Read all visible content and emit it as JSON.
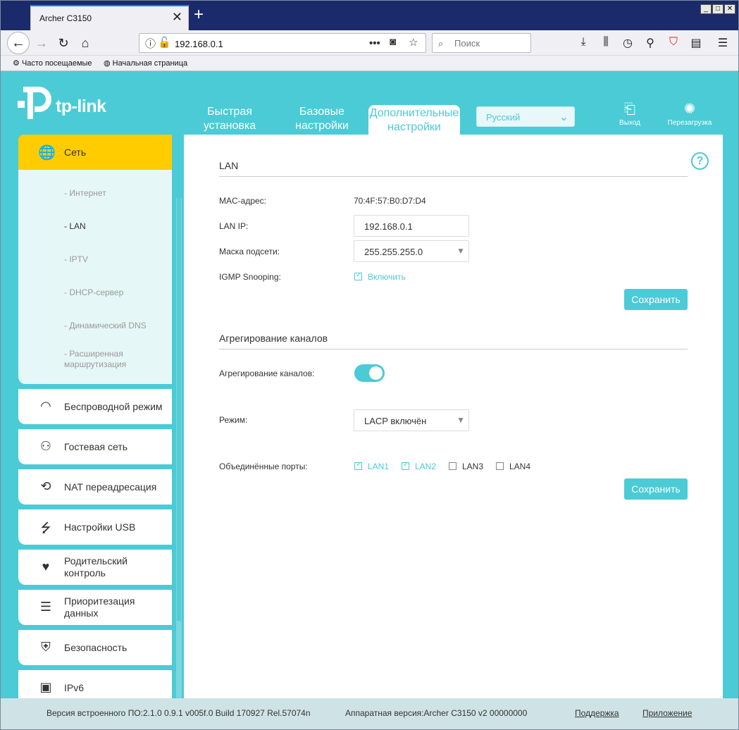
{
  "browser": {
    "tab_title": "Archer C3150",
    "tab_close": "✕",
    "newtab": "+",
    "url": "192.168.0.1",
    "search_placeholder": "Поиск",
    "window_controls": [
      "_",
      "□",
      "✕"
    ],
    "bookmarks": [
      "Часто посещаемые",
      "Начальная страница"
    ]
  },
  "router": {
    "brand": "tp-link",
    "topnav": [
      "Быстрая установка",
      "Базовые настройки",
      "Дополнительные настройки"
    ],
    "topnav_active": 2,
    "language": "Русский",
    "logout": "Выход",
    "reboot": "Перезагрузка"
  },
  "sidebar": {
    "active": {
      "label": "Сеть",
      "icon": "globe-icon"
    },
    "submenu": [
      "- Интернет",
      "- LAN",
      "- IPTV",
      "- DHCP-сервер",
      "- Динамический DNS",
      "- Расширенная маршрутизация"
    ],
    "selected_sub": 1,
    "items": [
      {
        "label": "Беспроводной режим",
        "icon": "wifi-icon"
      },
      {
        "label": "Гостевая сеть",
        "icon": "guest-users-icon"
      },
      {
        "label": "NAT переадресация",
        "icon": "nat-icon"
      },
      {
        "label": "Настройки USB",
        "icon": "usb-icon"
      },
      {
        "label": "Родительский контроль",
        "icon": "parental-icon"
      },
      {
        "label": "Приоритезация данных",
        "icon": "qos-icon"
      },
      {
        "label": "Безопасность",
        "icon": "shield-icon"
      },
      {
        "label": "IPv6",
        "icon": "ipv6-icon"
      }
    ]
  },
  "lan": {
    "heading": "LAN",
    "mac_label": "MAC-адрес:",
    "mac_value": "70:4F:57:B0:D7:D4",
    "ip_label": "LAN IP:",
    "ip_value": "192.168.0.1",
    "mask_label": "Маска подсети:",
    "mask_value": "255.255.255.0",
    "igmp_label": "IGMP Snooping:",
    "igmp_check": "Включить",
    "igmp_checked": true,
    "save": "Сохранить"
  },
  "aggregation": {
    "heading": "Агрегирование каналов",
    "toggle_label": "Агрегирование каналов:",
    "toggle_on": true,
    "mode_label": "Режим:",
    "mode_value": "LACP включён",
    "ports_label": "Объединённые порты:",
    "ports": [
      {
        "name": "LAN1",
        "checked": true
      },
      {
        "name": "LAN2",
        "checked": true
      },
      {
        "name": "LAN3",
        "checked": false
      },
      {
        "name": "LAN4",
        "checked": false
      }
    ],
    "save": "Сохранить"
  },
  "footer": {
    "firmware": "Версия встроенного ПО:2.1.0 0.9.1 v005f.0 Build 170927 Rel.57074n",
    "hardware": "Аппаратная версия:Archer C3150 v2 00000000",
    "support": "Поддержка",
    "app": "Приложение"
  },
  "colors": {
    "accent": "#4acbd6",
    "active": "#ffcc00"
  }
}
